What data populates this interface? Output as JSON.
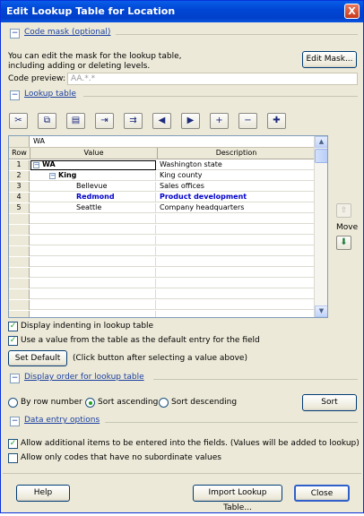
{
  "window": {
    "title": "Edit Lookup Table for Location",
    "close_glyph": "X"
  },
  "code_mask": {
    "section_label": "Code mask (optional)",
    "description_line1": "You can edit the mask for the lookup table,",
    "description_line2": "including adding or deleting levels.",
    "edit_mask_label": "Edit Mask...",
    "preview_label": "Code preview:",
    "preview_value": "AA.*.*"
  },
  "lookup": {
    "section_label": "Lookup table",
    "toolbar": [
      {
        "name": "cut-icon",
        "glyph": "✂"
      },
      {
        "name": "copy-icon",
        "glyph": "⧉"
      },
      {
        "name": "paste-icon",
        "glyph": "▤"
      },
      {
        "name": "insert-row-icon",
        "glyph": "⇥"
      },
      {
        "name": "insert-row-after-icon",
        "glyph": "⇉"
      },
      {
        "name": "arrow-left-icon",
        "glyph": "◀"
      },
      {
        "name": "arrow-right-icon",
        "glyph": "▶"
      },
      {
        "name": "plus-icon",
        "glyph": "+"
      },
      {
        "name": "minus-icon",
        "glyph": "−"
      },
      {
        "name": "add-multiple-icon",
        "glyph": "✚"
      }
    ],
    "edit_value": "WA",
    "columns": {
      "row": "Row",
      "value": "Value",
      "description": "Description"
    },
    "rows": [
      {
        "num": "1",
        "value": "WA",
        "desc": "Washington state",
        "level": 0,
        "tree": "−",
        "bold": true,
        "blue": false
      },
      {
        "num": "2",
        "value": "King",
        "desc": "King county",
        "level": 1,
        "tree": "−",
        "bold": true,
        "blue": false
      },
      {
        "num": "3",
        "value": "Bellevue",
        "desc": "Sales offices",
        "level": 2,
        "tree": "",
        "bold": false,
        "blue": false
      },
      {
        "num": "4",
        "value": "Redmond",
        "desc": "Product development",
        "level": 2,
        "tree": "",
        "bold": true,
        "blue": true
      },
      {
        "num": "5",
        "value": "Seattle",
        "desc": "Company headquarters",
        "level": 2,
        "tree": "",
        "bold": false,
        "blue": false
      }
    ],
    "blank_row_count": 13,
    "move_label": "Move",
    "display_indenting_label": "Display indenting in lookup table",
    "display_indenting_checked": true,
    "use_default_label": "Use a value from the table as the default entry for the field",
    "use_default_checked": true,
    "set_default_label": "Set Default",
    "set_default_hint": "(Click button after selecting a value above)"
  },
  "display_order": {
    "section_label": "Display order for lookup table",
    "options": [
      "By row number",
      "Sort ascending",
      "Sort descending"
    ],
    "selected_index": 1,
    "sort_label": "Sort"
  },
  "data_entry": {
    "section_label": "Data entry options",
    "allow_additional_label": "Allow additional items to be entered into the fields. (Values will be added to lookup)",
    "allow_additional_checked": true,
    "allow_only_codes_label": "Allow only codes that have no subordinate values",
    "allow_only_codes_checked": false
  },
  "footer": {
    "help": "Help",
    "import": "Import Lookup Table...",
    "close": "Close"
  },
  "colors": {
    "title_bar": "#0046d5",
    "link_blue": "#1a3fa0",
    "redmond_blue": "#0000cc",
    "check_green": "#21a121"
  }
}
